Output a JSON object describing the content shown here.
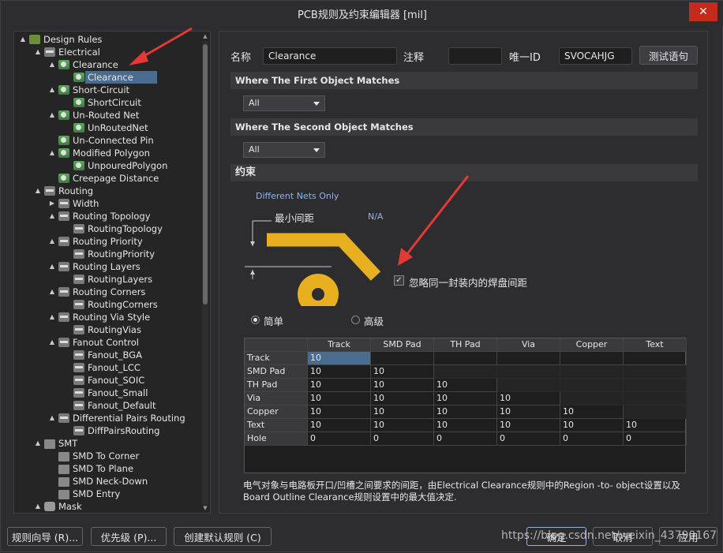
{
  "window": {
    "title": "PCB规则及约束编辑器 [mil]",
    "close_glyph": "✕"
  },
  "tree": {
    "items": [
      {
        "label": "Design Rules",
        "level": 0,
        "arrow": "▲",
        "icon": "root"
      },
      {
        "label": "Electrical",
        "level": 1,
        "arrow": "▲",
        "icon": "cat"
      },
      {
        "label": "Clearance",
        "level": 2,
        "arrow": "▲",
        "icon": "rule"
      },
      {
        "label": "Clearance",
        "level": 3,
        "arrow": "",
        "icon": "rule",
        "selected": true
      },
      {
        "label": "Short-Circuit",
        "level": 2,
        "arrow": "▲",
        "icon": "rule"
      },
      {
        "label": "ShortCircuit",
        "level": 3,
        "arrow": "",
        "icon": "rule"
      },
      {
        "label": "Un-Routed Net",
        "level": 2,
        "arrow": "▲",
        "icon": "rule"
      },
      {
        "label": "UnRoutedNet",
        "level": 3,
        "arrow": "",
        "icon": "rule"
      },
      {
        "label": "Un-Connected Pin",
        "level": 2,
        "arrow": "",
        "icon": "rule"
      },
      {
        "label": "Modified Polygon",
        "level": 2,
        "arrow": "▲",
        "icon": "rule"
      },
      {
        "label": "UnpouredPolygon",
        "level": 3,
        "arrow": "",
        "icon": "rule"
      },
      {
        "label": "Creepage Distance",
        "level": 2,
        "arrow": "",
        "icon": "rule"
      },
      {
        "label": "Routing",
        "level": 1,
        "arrow": "▲",
        "icon": "cat"
      },
      {
        "label": "Width",
        "level": 2,
        "arrow": "▶",
        "icon": "cat"
      },
      {
        "label": "Routing Topology",
        "level": 2,
        "arrow": "▲",
        "icon": "cat"
      },
      {
        "label": "RoutingTopology",
        "level": 3,
        "arrow": "",
        "icon": "cat"
      },
      {
        "label": "Routing Priority",
        "level": 2,
        "arrow": "▲",
        "icon": "cat"
      },
      {
        "label": "RoutingPriority",
        "level": 3,
        "arrow": "",
        "icon": "cat"
      },
      {
        "label": "Routing Layers",
        "level": 2,
        "arrow": "▲",
        "icon": "cat"
      },
      {
        "label": "RoutingLayers",
        "level": 3,
        "arrow": "",
        "icon": "cat"
      },
      {
        "label": "Routing Corners",
        "level": 2,
        "arrow": "▲",
        "icon": "cat"
      },
      {
        "label": "RoutingCorners",
        "level": 3,
        "arrow": "",
        "icon": "cat"
      },
      {
        "label": "Routing Via Style",
        "level": 2,
        "arrow": "▲",
        "icon": "cat"
      },
      {
        "label": "RoutingVias",
        "level": 3,
        "arrow": "",
        "icon": "cat"
      },
      {
        "label": "Fanout Control",
        "level": 2,
        "arrow": "▲",
        "icon": "cat"
      },
      {
        "label": "Fanout_BGA",
        "level": 3,
        "arrow": "",
        "icon": "cat"
      },
      {
        "label": "Fanout_LCC",
        "level": 3,
        "arrow": "",
        "icon": "cat"
      },
      {
        "label": "Fanout_SOIC",
        "level": 3,
        "arrow": "",
        "icon": "cat"
      },
      {
        "label": "Fanout_Small",
        "level": 3,
        "arrow": "",
        "icon": "cat"
      },
      {
        "label": "Fanout_Default",
        "level": 3,
        "arrow": "",
        "icon": "cat"
      },
      {
        "label": "Differential Pairs Routing",
        "level": 2,
        "arrow": "▲",
        "icon": "cat"
      },
      {
        "label": "DiffPairsRouting",
        "level": 3,
        "arrow": "",
        "icon": "cat"
      },
      {
        "label": "SMT",
        "level": 1,
        "arrow": "▲",
        "icon": "smt"
      },
      {
        "label": "SMD To Corner",
        "level": 2,
        "arrow": "",
        "icon": "smt"
      },
      {
        "label": "SMD To Plane",
        "level": 2,
        "arrow": "",
        "icon": "smt"
      },
      {
        "label": "SMD Neck-Down",
        "level": 2,
        "arrow": "",
        "icon": "smt"
      },
      {
        "label": "SMD Entry",
        "level": 2,
        "arrow": "",
        "icon": "smt"
      },
      {
        "label": "Mask",
        "level": 1,
        "arrow": "▲",
        "icon": "mask"
      }
    ]
  },
  "rule": {
    "name_label": "名称",
    "name_value": "Clearance",
    "comment_label": "注释",
    "comment_value": "",
    "uid_label": "唯一ID",
    "uid_value": "SVOCAHJG",
    "test_button": "测试语句"
  },
  "first_match": {
    "header": "Where The First Object Matches",
    "value": "All"
  },
  "second_match": {
    "header": "Where The Second Object Matches",
    "value": "All"
  },
  "constraints": {
    "header": "约束",
    "different_nets": "Different Nets Only",
    "min_clearance_label": "最小间距",
    "na_text": "N/A",
    "ignore_pad_checkbox": "忽略同一封装内的焊盘间距",
    "ignore_pad_checked": true,
    "simple_label": "简单",
    "advanced_label": "高级",
    "mode": "simple",
    "trace_color": "#e8b020"
  },
  "grid": {
    "columns": [
      "",
      "Track",
      "SMD Pad",
      "TH Pad",
      "Via",
      "Copper",
      "Text"
    ],
    "rows": [
      {
        "name": "Track",
        "values": [
          "10",
          "",
          "",
          "",
          "",
          ""
        ]
      },
      {
        "name": "SMD Pad",
        "values": [
          "10",
          "10",
          "",
          "",
          "",
          ""
        ]
      },
      {
        "name": "TH Pad",
        "values": [
          "10",
          "10",
          "10",
          "",
          "",
          ""
        ]
      },
      {
        "name": "Via",
        "values": [
          "10",
          "10",
          "10",
          "10",
          "",
          ""
        ]
      },
      {
        "name": "Copper",
        "values": [
          "10",
          "10",
          "10",
          "10",
          "10",
          ""
        ]
      },
      {
        "name": "Text",
        "values": [
          "10",
          "10",
          "10",
          "10",
          "10",
          "10"
        ]
      },
      {
        "name": "Hole",
        "values": [
          "0",
          "0",
          "0",
          "0",
          "0",
          "0"
        ]
      }
    ]
  },
  "description": "电气对象与电路板开口/凹槽之间要求的间距，由Electrical Clearance规则中的Region -to- object设置以及Board Outline Clearance规则设置中的最大值决定.",
  "footer": {
    "wizard": "规则向导 (R)...",
    "priority": "优先级 (P)...",
    "create_default": "创建默认规则 (C)",
    "ok": "确定",
    "cancel": "取消",
    "apply": "应用"
  },
  "watermark": "https://blog.csdn.net/weixin_43790167"
}
